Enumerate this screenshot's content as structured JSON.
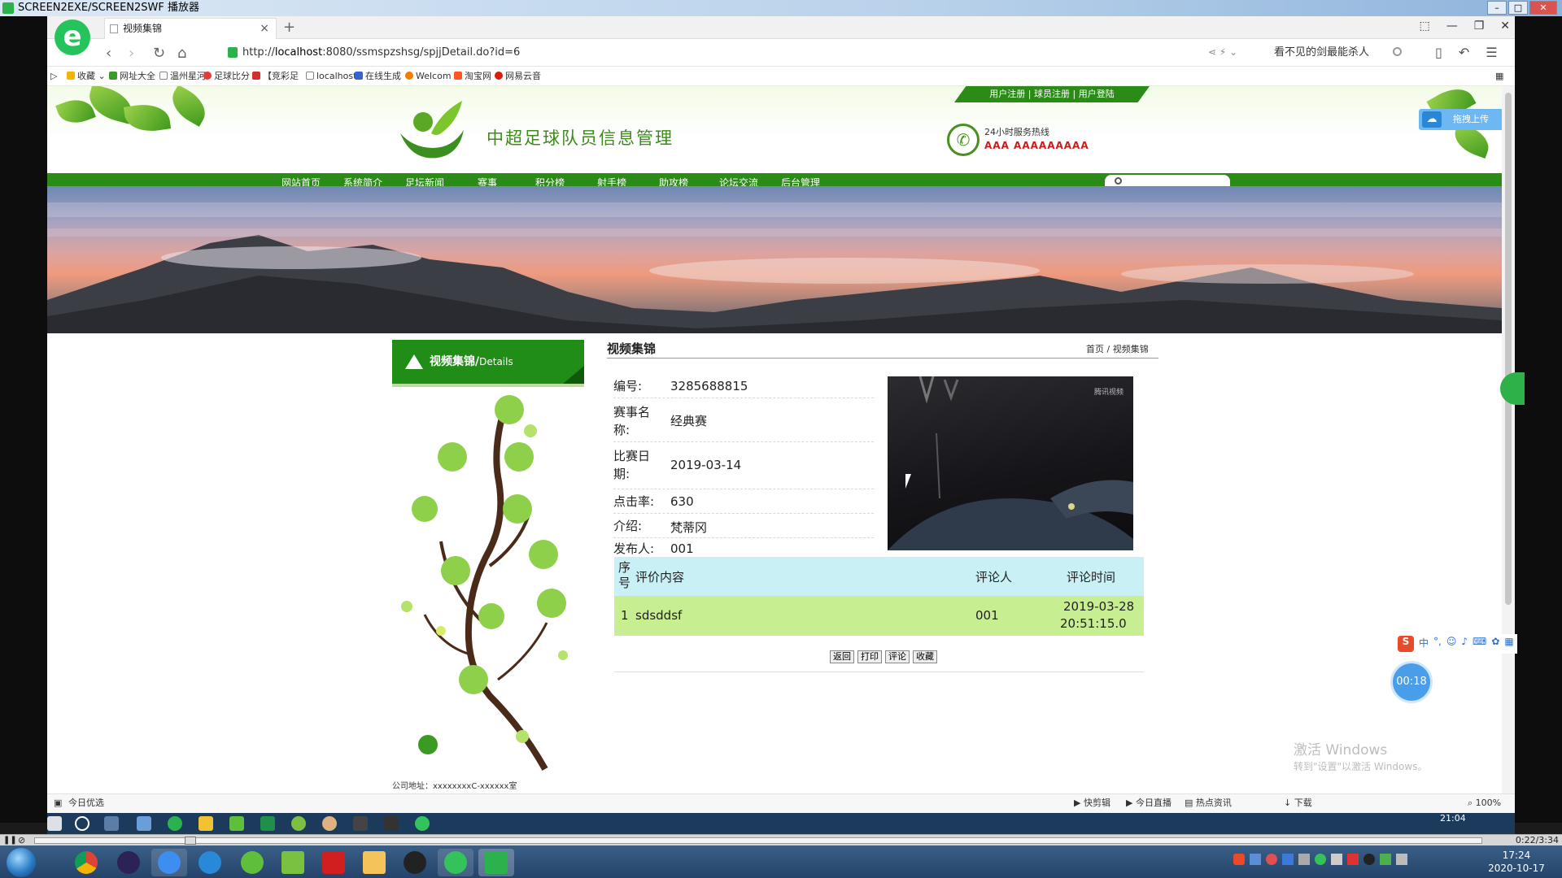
{
  "player": {
    "title": "SCREEN2EXE/SCREEN2SWF 播放器",
    "seek_time": "0:22/3:34"
  },
  "browser": {
    "tab_title": "视频集锦",
    "url_prefix": "http://",
    "url_host": "localhost",
    "url_rest": ":8080/ssmspzshsg/spjjDetail.do?id=6",
    "search_value": "看不见的剑最能杀人",
    "bookmarks": [
      "收藏",
      "网址大全",
      "温州星河",
      "足球比分",
      "【竞彩足",
      "localhost",
      "在线生成",
      "Welcom",
      "淘宝网",
      "网易云音"
    ],
    "status_left": "今日优选",
    "status_right": [
      "快剪辑",
      "今日直播",
      "热点资讯",
      "下载",
      "100%"
    ]
  },
  "site": {
    "top_links": "用户注册 | 球员注册 | 用户登陆",
    "title": "中超足球队员信息管理",
    "hotline_label": "24小时服务热线",
    "hotline_number": "AAA AAAAAAAAA",
    "upload_label": "拖拽上传",
    "menu": [
      "网站首页",
      "系统简介",
      "足坛新闻",
      "赛事",
      "积分榜",
      "射手榜",
      "助攻榜",
      "论坛交流",
      "后台管理"
    ],
    "side_title": "视频集锦/",
    "side_title_small": "Details",
    "address": "公司地址：xxxxxxxxC-xxxxxx室"
  },
  "detail": {
    "heading": "视频集锦",
    "crumb_home": "首页",
    "crumb_sep": "/",
    "crumb_current": "视频集锦",
    "fields": [
      {
        "label": "编号:",
        "value": "3285688815"
      },
      {
        "label": "赛事名称:",
        "value": "经典赛"
      },
      {
        "label": "比赛日期:",
        "value": "2019-03-14"
      },
      {
        "label": "点击率:",
        "value": "630"
      },
      {
        "label": "介绍:",
        "value": "梵蒂冈"
      },
      {
        "label": "发布人:",
        "value": "001"
      }
    ],
    "video_watermark": "腾讯视频",
    "comments": {
      "headers": [
        "序号",
        "评价内容",
        "评论人",
        "评论时间"
      ],
      "rows": [
        {
          "no": "1",
          "content": "sdsddsf",
          "user": "001",
          "date": "2019-03-28",
          "time": "20:51:15.0"
        }
      ]
    },
    "buttons": [
      "返回",
      "打印",
      "评论",
      "收藏"
    ]
  },
  "desktop": {
    "inner_clock": "21:04",
    "clock_time": "17:24",
    "clock_date": "2020-10-17",
    "activate_title": "激活 Windows",
    "activate_sub": "转到\"设置\"以激活 Windows。",
    "rec_timer": "00:18",
    "ime_label": "中"
  }
}
